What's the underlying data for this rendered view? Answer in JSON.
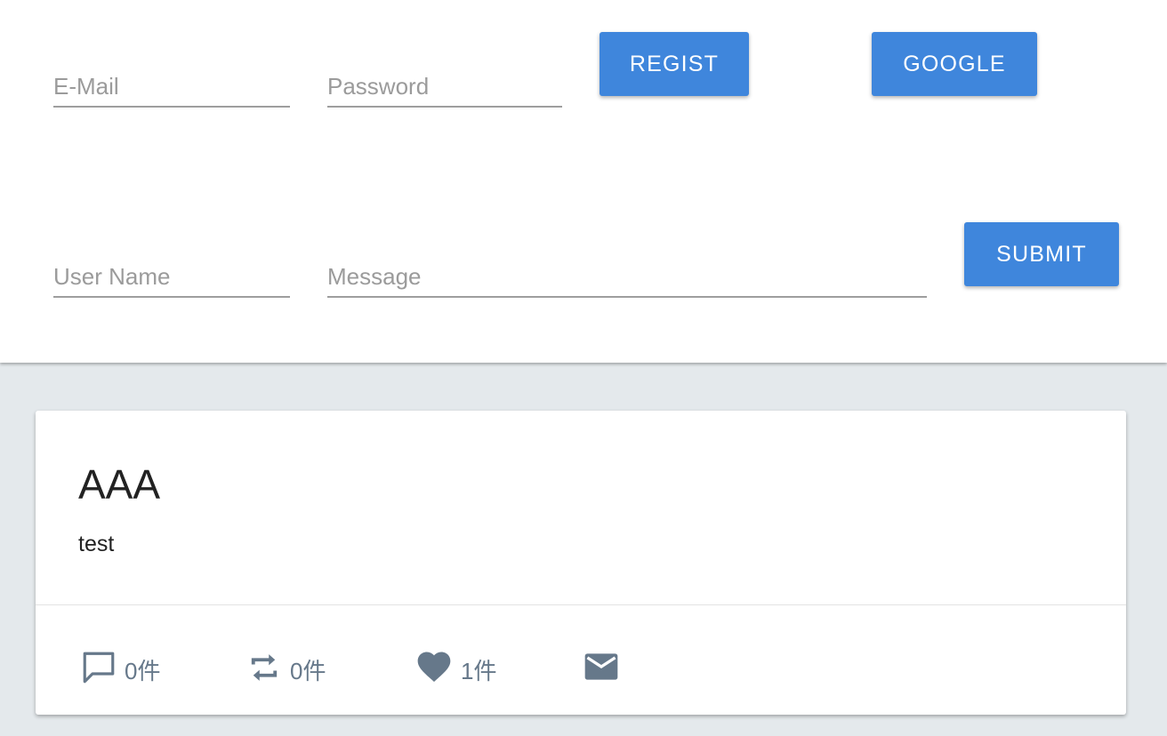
{
  "auth": {
    "email_placeholder": "E-Mail",
    "email_value": "",
    "password_placeholder": "Password",
    "password_value": "",
    "regist_label": "REGIST",
    "google_label": "GOOGLE"
  },
  "post_form": {
    "username_placeholder": "User Name",
    "username_value": "",
    "message_placeholder": "Message",
    "message_value": "",
    "submit_label": "SUBMIT"
  },
  "posts": [
    {
      "title": "AAA",
      "text": "test",
      "actions": {
        "comment_icon": "comment-icon",
        "comment_count": "0件",
        "retweet_icon": "retweet-icon",
        "retweet_count": "0件",
        "like_icon": "heart-icon",
        "like_count": "1件",
        "mail_icon": "mail-icon"
      }
    }
  ],
  "colors": {
    "accent": "#3f86dc",
    "background": "#e4e9ec",
    "icon": "#66788a"
  }
}
